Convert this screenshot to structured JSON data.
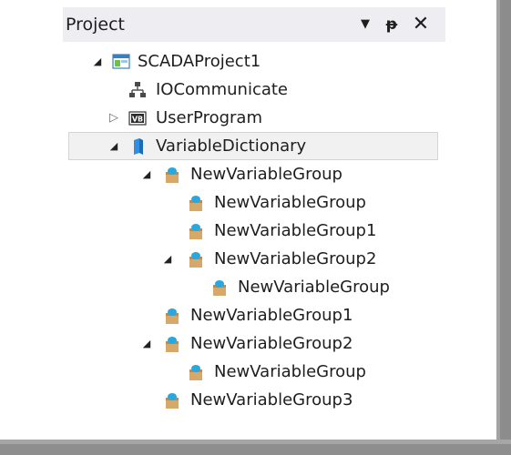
{
  "panel": {
    "title": "Project",
    "buttons": {
      "dropdown": "▼",
      "pin": "ᵽ",
      "close": "✕"
    }
  },
  "tree": {
    "nodes": [
      {
        "label": "SCADAProject1",
        "icon": "project-icon",
        "state": "expanded"
      },
      {
        "label": "IOCommunicate",
        "icon": "network-icon",
        "state": "leaf"
      },
      {
        "label": "UserProgram",
        "icon": "vb-icon",
        "state": "collapsed"
      },
      {
        "label": "VariableDictionary",
        "icon": "dictionary-icon",
        "state": "expanded",
        "selected": true
      },
      {
        "label": "NewVariableGroup",
        "icon": "variable-group-icon",
        "state": "expanded"
      },
      {
        "label": "NewVariableGroup",
        "icon": "variable-group-icon",
        "state": "leaf"
      },
      {
        "label": "NewVariableGroup1",
        "icon": "variable-group-icon",
        "state": "leaf"
      },
      {
        "label": "NewVariableGroup2",
        "icon": "variable-group-icon",
        "state": "expanded"
      },
      {
        "label": "NewVariableGroup",
        "icon": "variable-group-icon",
        "state": "leaf"
      },
      {
        "label": "NewVariableGroup1",
        "icon": "variable-group-icon",
        "state": "leaf"
      },
      {
        "label": "NewVariableGroup2",
        "icon": "variable-group-icon",
        "state": "expanded"
      },
      {
        "label": "NewVariableGroup",
        "icon": "variable-group-icon",
        "state": "leaf"
      },
      {
        "label": "NewVariableGroup3",
        "icon": "variable-group-icon",
        "state": "leaf"
      }
    ]
  },
  "colors": {
    "header_bg": "#eeeef2",
    "selection_bg": "#f1f1f1",
    "frame": "#a3a3a3"
  }
}
